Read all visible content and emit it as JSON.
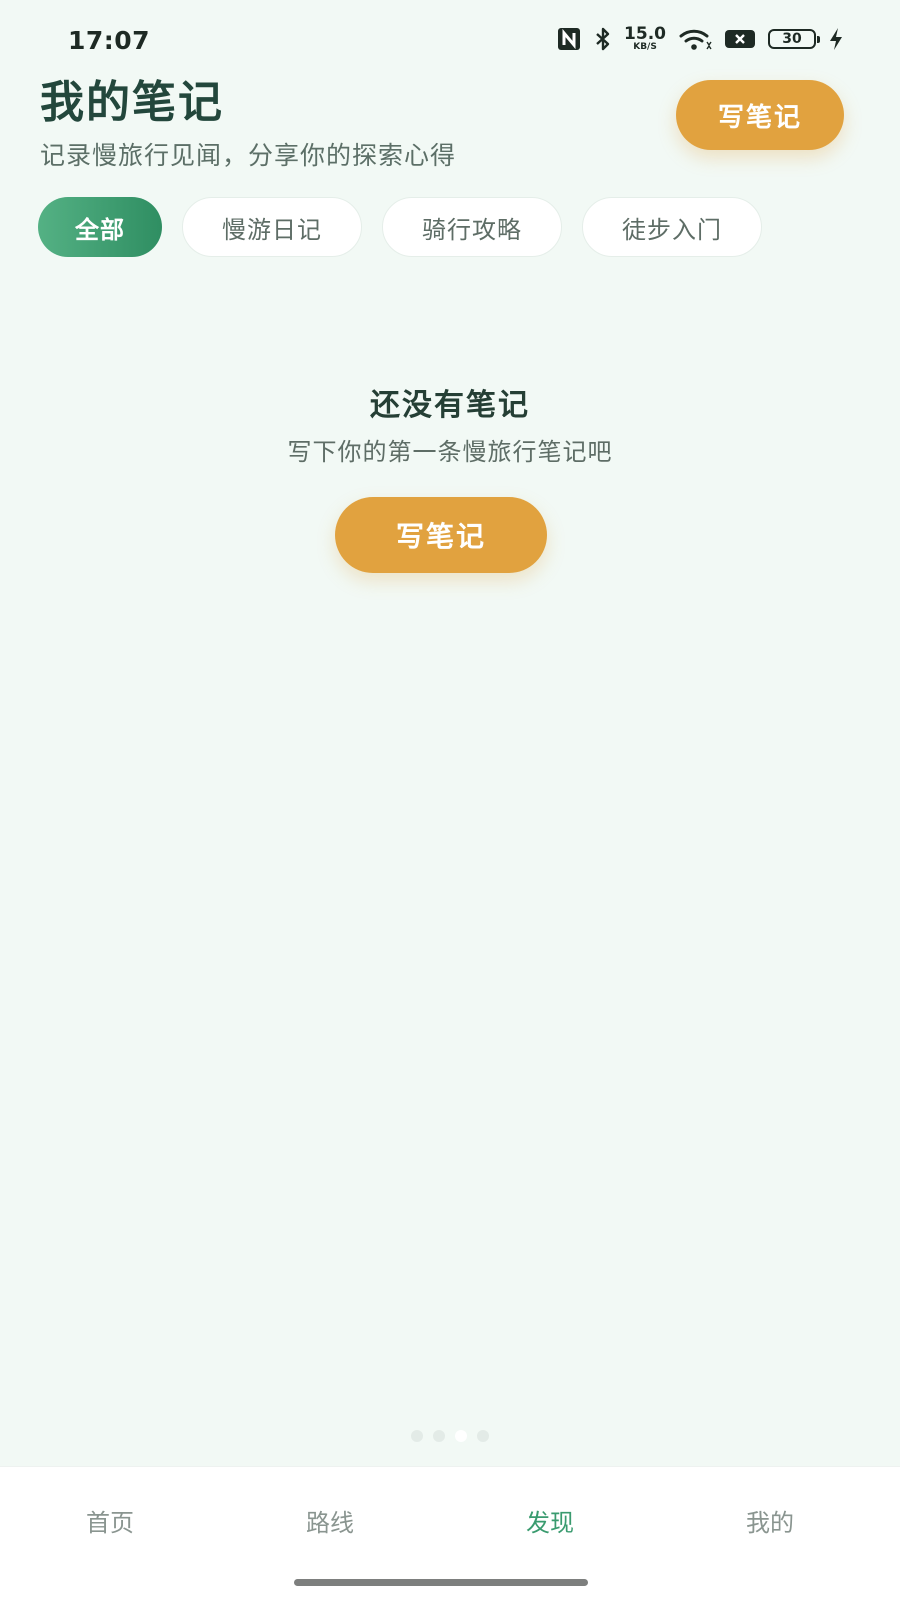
{
  "status_bar": {
    "time": "17:07",
    "net_speed_value": "15.0",
    "net_speed_unit": "KB/S",
    "battery": "30",
    "icons": [
      "nfc-icon",
      "bluetooth-icon",
      "wifi-icon",
      "sim-disabled-icon",
      "battery-icon",
      "charging-icon"
    ]
  },
  "header": {
    "title": "我的笔记",
    "subtitle": "记录慢旅行见闻，分享你的探索心得",
    "write_button": "写笔记"
  },
  "tabs": [
    {
      "label": "全部",
      "active": true
    },
    {
      "label": "慢游日记",
      "active": false
    },
    {
      "label": "骑行攻略",
      "active": false
    },
    {
      "label": "徒步入门",
      "active": false
    }
  ],
  "empty_state": {
    "title": "还没有笔记",
    "description": "写下你的第一条慢旅行笔记吧",
    "button": "写笔记"
  },
  "bottom_nav": {
    "items": [
      {
        "label": "首页",
        "active": false
      },
      {
        "label": "路线",
        "active": false
      },
      {
        "label": "发现",
        "active": true
      },
      {
        "label": "我的",
        "active": false
      }
    ]
  },
  "colors": {
    "background": "#f2f9f5",
    "accent_orange": "#e1a23f",
    "accent_green": "#3a9b6f",
    "title_text": "#23473c"
  }
}
